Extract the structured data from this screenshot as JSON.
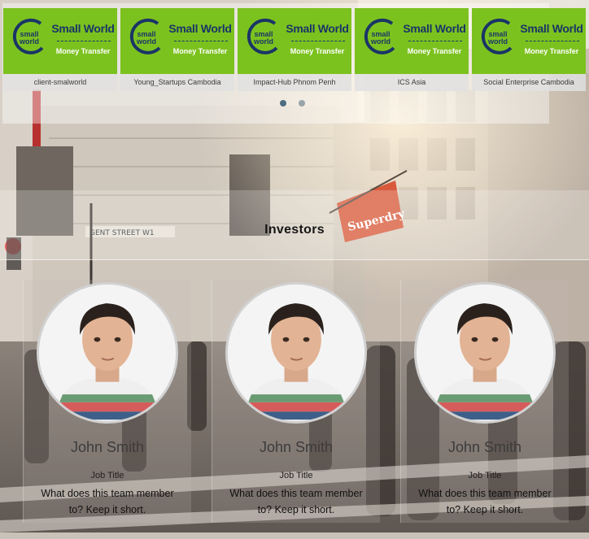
{
  "partners": [
    {
      "brand": "Small World",
      "tagline": "Money Transfer",
      "logo_text": "small world",
      "caption": "client-smalworld"
    },
    {
      "brand": "Small World",
      "tagline": "Money Transfer",
      "logo_text": "small world",
      "caption": "Young_Startups Cambodia"
    },
    {
      "brand": "Small World",
      "tagline": "Money Transfer",
      "logo_text": "small world",
      "caption": "Impact-Hub Phnom Penh"
    },
    {
      "brand": "Small World",
      "tagline": "Money Transfer",
      "logo_text": "small world",
      "caption": "ICS Asia"
    },
    {
      "brand": "Small World",
      "tagline": "Money Transfer",
      "logo_text": "small world",
      "caption": "Social Enterprise Cambodia"
    }
  ],
  "carousel": {
    "pages": 2,
    "active_page": 1
  },
  "investors": {
    "title": "Investors",
    "members": [
      {
        "name": "John Smith",
        "role": "Job Title",
        "desc_line1": "What does this team member",
        "desc_line2": "to? Keep it short."
      },
      {
        "name": "John Smith",
        "role": "Job Title",
        "desc_line1": "What does this team member",
        "desc_line2": "to? Keep it short."
      },
      {
        "name": "John Smith",
        "role": "Job Title",
        "desc_line1": "What does this team member",
        "desc_line2": "to? Keep it short."
      }
    ]
  },
  "background": {
    "sign_text": "Superdry",
    "street_text": "GENT STREET W1"
  },
  "colors": {
    "logo_green": "#7cc21f",
    "logo_navy": "#1a3566",
    "dot_active": "#4c6e80",
    "dot_inactive": "#9aa4ab"
  }
}
